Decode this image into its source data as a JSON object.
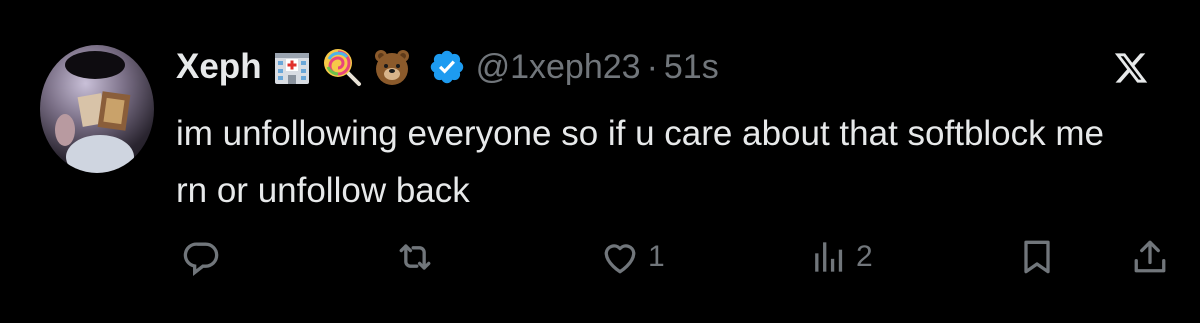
{
  "post": {
    "author_name": "Xeph",
    "emojis": [
      "hospital-emoji",
      "lollipop-emoji",
      "bear-emoji"
    ],
    "verified": true,
    "handle": "@1xeph23",
    "separator": "·",
    "time": "51s",
    "text": "im unfollowing everyone so if u care about that softblock me rn or unfollow back"
  },
  "actions": {
    "reply_icon": "reply-icon",
    "repost_icon": "repost-icon",
    "like_icon": "heart-icon",
    "like_count": "1",
    "views_icon": "views-bar-chart-icon",
    "views_count": "2",
    "bookmark_icon": "bookmark-icon",
    "share_icon": "share-icon"
  },
  "colors": {
    "background": "#000000",
    "text": "#e7e9ea",
    "muted": "#71767b",
    "verified_blue": "#1d9bf0"
  }
}
